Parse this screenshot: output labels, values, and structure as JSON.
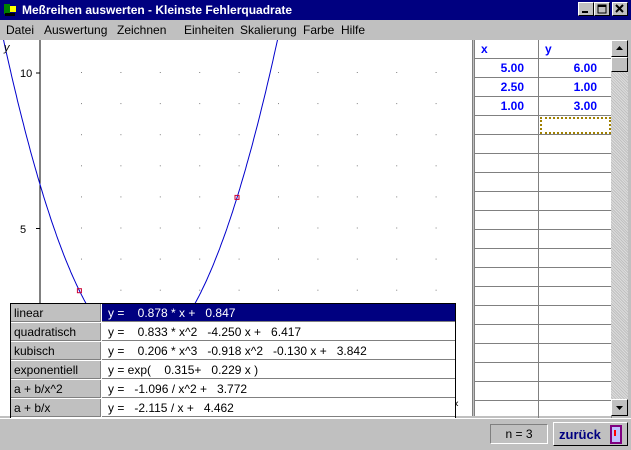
{
  "window": {
    "title": "Meßreihen auswerten - Kleinste Fehlerquadrate",
    "controls": [
      "minimize-icon",
      "maximize-icon",
      "close-icon"
    ]
  },
  "menu": [
    {
      "label": "Datei"
    },
    {
      "label": "Auswertung"
    },
    {
      "label": "Zeichnen"
    },
    {
      "label": "Einheiten"
    },
    {
      "label": "Skalierung"
    },
    {
      "label": "Farbe"
    },
    {
      "label": "Hilfe"
    }
  ],
  "plot": {
    "y_axis_label": "y",
    "y_ticks": [
      "10",
      "5"
    ],
    "curve_color": "#0000cc",
    "point_color": "#cc0033",
    "grid_dots": true
  },
  "chart_data": {
    "type": "scatter",
    "x": [
      5.0,
      2.5,
      1.0
    ],
    "y": [
      6.0,
      1.0,
      3.0
    ],
    "fit": {
      "type": "quadratic",
      "a": 6.417,
      "b": -4.25,
      "c": 0.833
    },
    "ylabel": "y",
    "ylim": [
      0,
      12
    ]
  },
  "fits": [
    {
      "name": "linear",
      "equation": "y =    0.878 * x +   0.847",
      "selected": true
    },
    {
      "name": "quadratisch",
      "equation": "y =    0.833 * x^2   -4.250 x +   6.417",
      "selected": false
    },
    {
      "name": "kubisch",
      "equation": "y =    0.206 * x^3   -0.918 x^2   -0.130 x +   3.842",
      "selected": false
    },
    {
      "name": "exponentiell",
      "equation": "y = exp(    0.315+   0.229 x )",
      "selected": false
    },
    {
      "name": "a + b/x^2",
      "equation": "y =   -1.096 / x^2 +   3.772",
      "selected": false
    },
    {
      "name": "a + b/x",
      "equation": "y =   -2.115 / x +   4.462",
      "selected": false
    }
  ],
  "table": {
    "headers": [
      "x",
      "y"
    ],
    "rows": [
      {
        "x": "5.00",
        "y": "6.00"
      },
      {
        "x": "2.50",
        "y": "1.00"
      },
      {
        "x": "1.00",
        "y": "3.00"
      }
    ]
  },
  "scroll_chevron": "‹",
  "status": {
    "count": "n = 3",
    "back_label": "zurück"
  }
}
